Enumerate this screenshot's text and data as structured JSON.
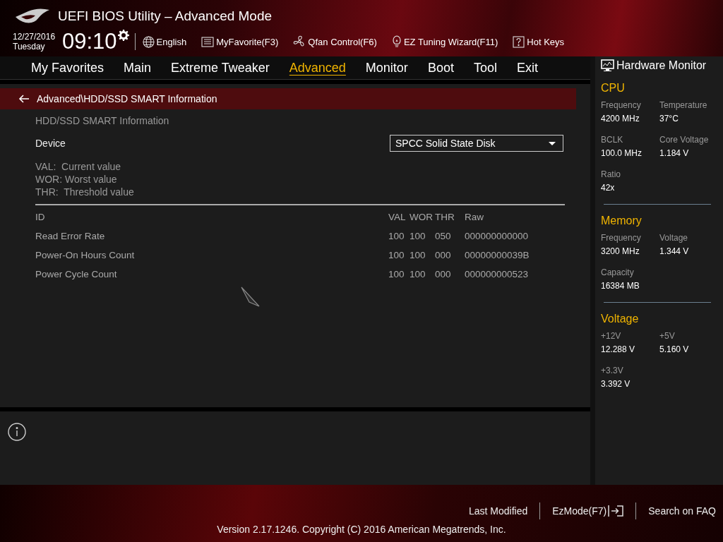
{
  "header": {
    "title": "UEFI BIOS Utility – Advanced Mode",
    "date": "12/27/2016",
    "day": "Tuesday",
    "time": "09:10",
    "tools": [
      {
        "kind": "globe",
        "label": "English"
      },
      {
        "kind": "list",
        "label": "MyFavorite(F3)"
      },
      {
        "kind": "fan",
        "label": "Qfan Control(F6)"
      },
      {
        "kind": "bulb",
        "label": "EZ Tuning Wizard(F11)"
      },
      {
        "kind": "help",
        "label": "Hot Keys"
      }
    ]
  },
  "tabs": [
    {
      "label": "My Favorites",
      "selected": false
    },
    {
      "label": "Main",
      "selected": false
    },
    {
      "label": "Extreme Tweaker",
      "selected": false
    },
    {
      "label": "Advanced",
      "selected": true
    },
    {
      "label": "Monitor",
      "selected": false
    },
    {
      "label": "Boot",
      "selected": false
    },
    {
      "label": "Tool",
      "selected": false
    },
    {
      "label": "Exit",
      "selected": false
    }
  ],
  "breadcrumb": "Advanced\\HDD/SSD SMART Information",
  "section_title": "HDD/SSD SMART Information",
  "device": {
    "label": "Device",
    "value": "SPCC Solid State Disk"
  },
  "legend": [
    "VAL:  Current value",
    "WOR: Worst value",
    "THR:  Threshold value"
  ],
  "table": {
    "columns": [
      "ID",
      "VAL",
      "WOR",
      "THR",
      "Raw"
    ],
    "rows": [
      [
        "Read Error Rate",
        "100",
        "100",
        "050",
        "000000000000"
      ],
      [
        "Power-On Hours Count",
        "100",
        "100",
        "000",
        "00000000039B"
      ],
      [
        "Power Cycle Count",
        "100",
        "100",
        "000",
        "000000000523"
      ]
    ]
  },
  "hardware_monitor": {
    "title": "Hardware Monitor",
    "sections": [
      {
        "title": "CPU",
        "items": [
          {
            "label": "Frequency",
            "value": "4200 MHz"
          },
          {
            "label": "Temperature",
            "value": "37°C"
          },
          {
            "label": "BCLK",
            "value": "100.0 MHz"
          },
          {
            "label": "Core Voltage",
            "value": "1.184 V"
          },
          {
            "label": "Ratio",
            "value": "42x"
          }
        ]
      },
      {
        "title": "Memory",
        "items": [
          {
            "label": "Frequency",
            "value": "3200 MHz"
          },
          {
            "label": "Voltage",
            "value": "1.344 V"
          },
          {
            "label": "Capacity",
            "value": "16384 MB"
          }
        ]
      },
      {
        "title": "Voltage",
        "items": [
          {
            "label": "+12V",
            "value": "12.288 V"
          },
          {
            "label": "+5V",
            "value": "5.160 V"
          },
          {
            "label": "+3.3V",
            "value": "3.392 V"
          }
        ]
      }
    ]
  },
  "footer": {
    "links": [
      {
        "kind": "text",
        "label": "Last Modified"
      },
      {
        "kind": "exit",
        "label": "EzMode(F7)"
      },
      {
        "kind": "text",
        "label": "Search on FAQ"
      }
    ],
    "copyright": "Version 2.17.1246. Copyright (C) 2016 American Megatrends, Inc."
  }
}
